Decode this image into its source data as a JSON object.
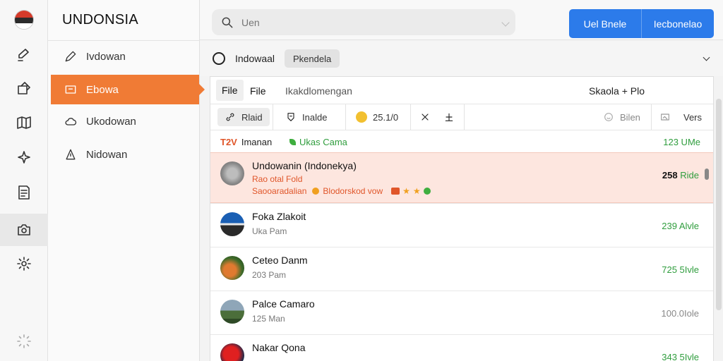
{
  "app": {
    "title": "UNDONSIA"
  },
  "rail": {
    "icons": [
      "flag-icon",
      "edit-icon",
      "message-icon",
      "map-icon",
      "sparkle-icon",
      "notes-icon",
      "camera-icon",
      "settings-icon",
      "loading-icon"
    ]
  },
  "sidebar": {
    "items": [
      {
        "label": "Ivdowan",
        "icon": "pencil-icon"
      },
      {
        "label": "Ebowa",
        "icon": "folder-icon"
      },
      {
        "label": "Ukodowan",
        "icon": "cloud-icon"
      },
      {
        "label": "Nidowan",
        "icon": "person-icon"
      }
    ]
  },
  "search": {
    "placeholder": "Uen"
  },
  "header_buttons": {
    "primary": "Uel Bnele",
    "secondary": "Iecbonelao"
  },
  "subheader": {
    "label": "Indowaal",
    "chip": "Pkendela"
  },
  "file_row": {
    "tab1": "File",
    "tab2": "File",
    "breadcrumb": "Ikakdlomengan",
    "right": "Skaola + Plo"
  },
  "toolbar": {
    "filter": "Rlaid",
    "tools": "Inalde",
    "count": "25.1/0",
    "filter_right": "Bilen",
    "vers": "Vers"
  },
  "labels": {
    "tag1_prefix": "T2V",
    "tag1": "Imanan",
    "tag2": "Ukas Cama",
    "size": "123 UMe"
  },
  "rows": [
    {
      "title": "Undowanin (Indonekya)",
      "subtitle": "Rao otal Fold",
      "tags_text1": "Saooaradalian",
      "tags_text2": "Blodorskod vow",
      "size_bold": "258",
      "size_rest": "Ride",
      "highlighted": true
    },
    {
      "title": "Foka Zlakoit",
      "subtitle": "Uka Pam",
      "size": "239 Alvle",
      "size_color": "green"
    },
    {
      "title": "Ceteo Danm",
      "subtitle": "203 Pam",
      "size": "725 5Ivle",
      "size_color": "green"
    },
    {
      "title": "Palce Camaro",
      "subtitle": "125 Man",
      "size": "100.0Iole",
      "size_color": "grey"
    },
    {
      "title": "Nakar Qona",
      "subtitle": "",
      "size": "343 5Ivle",
      "size_color": "green"
    }
  ],
  "colors": {
    "accent": "#f07b35",
    "primary": "#2c7bea",
    "green": "#2f9d3d",
    "highlight": "#fde6df"
  }
}
